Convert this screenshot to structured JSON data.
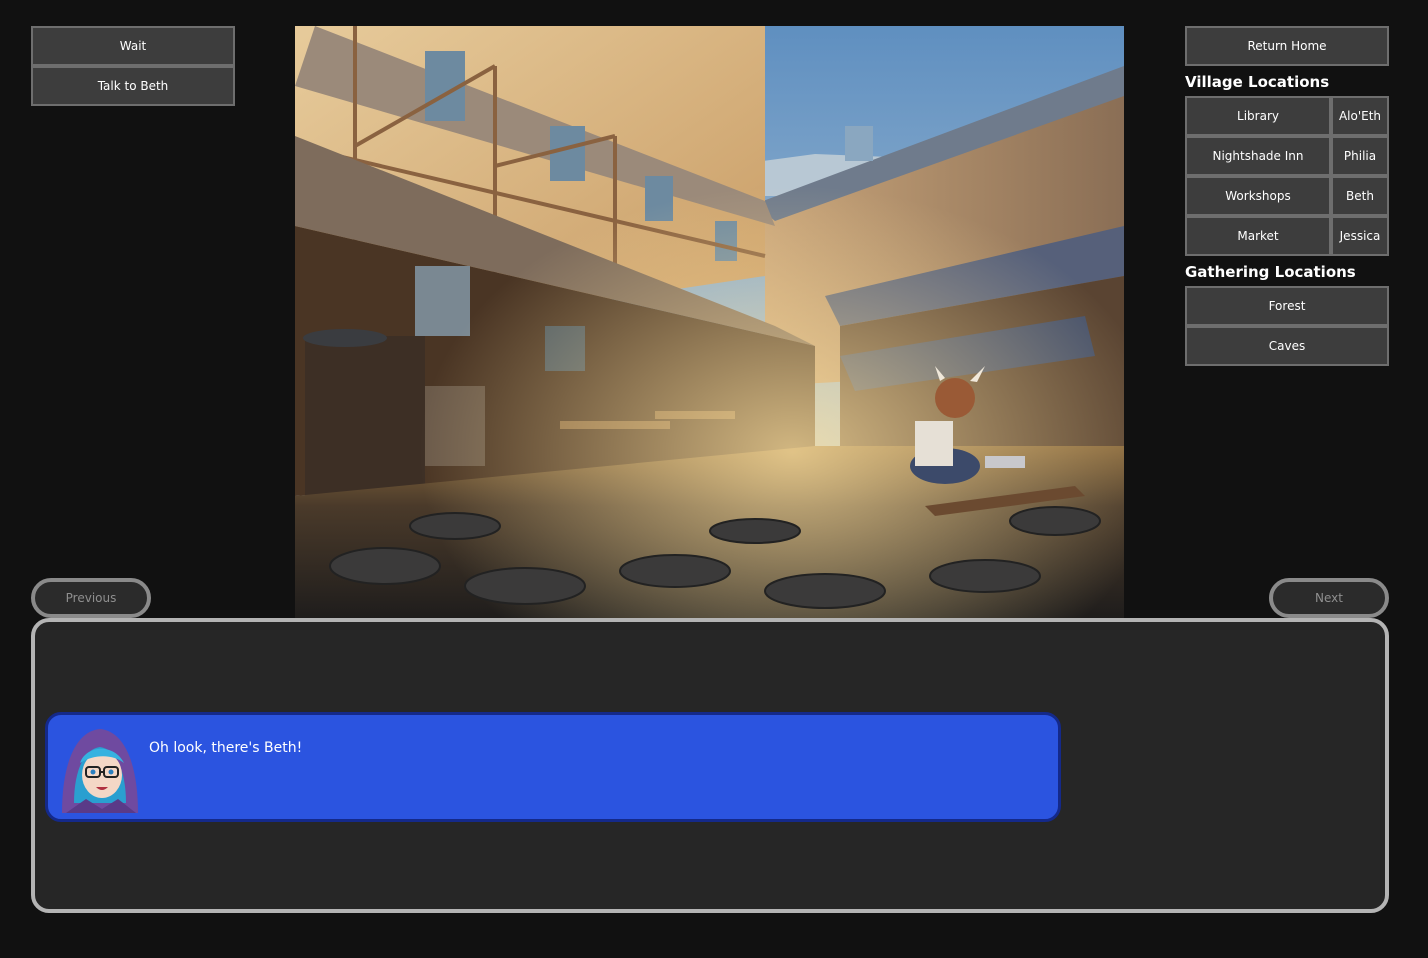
{
  "actions": {
    "wait_label": "Wait",
    "talk_label": "Talk to Beth"
  },
  "navigation": {
    "return_home_label": "Return Home",
    "village_title": "Village Locations",
    "village": [
      {
        "location": "Library",
        "npc": "Alo'Eth"
      },
      {
        "location": "Nightshade Inn",
        "npc": "Philia"
      },
      {
        "location": "Workshops",
        "npc": "Beth"
      },
      {
        "location": "Market",
        "npc": "Jessica"
      }
    ],
    "gathering_title": "Gathering Locations",
    "gathering": [
      "Forest",
      "Caves"
    ]
  },
  "pager": {
    "previous_label": "Previous",
    "next_label": "Next"
  },
  "dialogue": {
    "text": "Oh look, there's Beth!"
  },
  "colors": {
    "background": "#111111",
    "button": "#3d3d3d",
    "bubble": "#2b54e0",
    "panel": "#262626"
  }
}
